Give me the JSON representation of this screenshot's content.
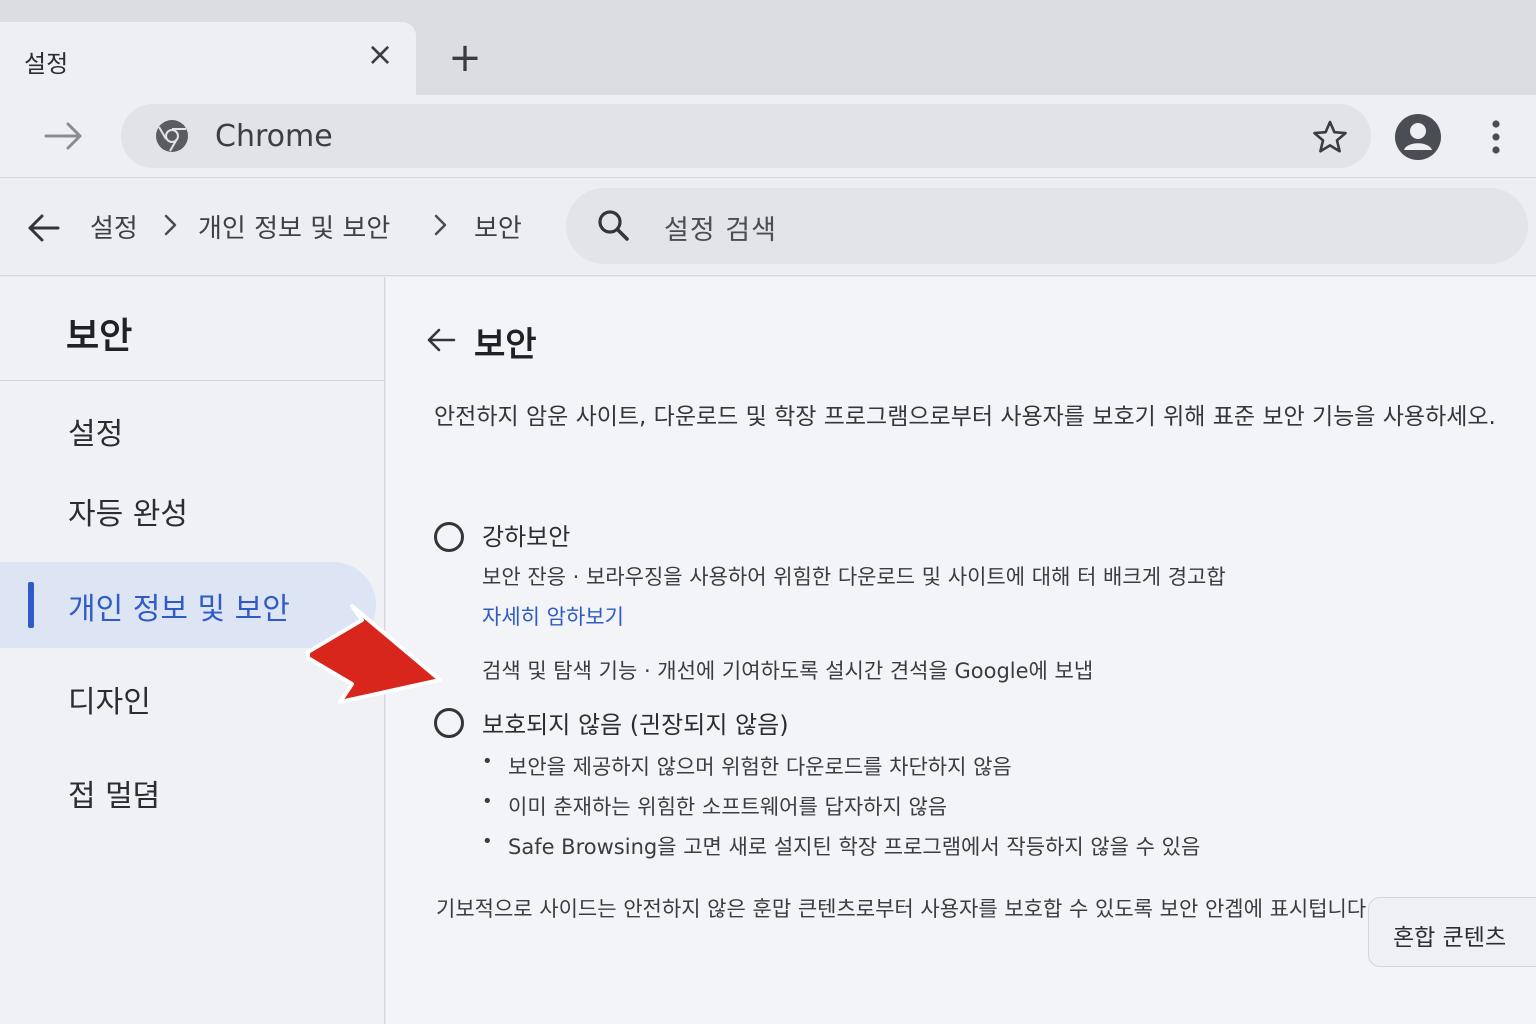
{
  "tab": {
    "title": "설정",
    "close_icon": "close-icon",
    "new_tab_icon": "plus-icon"
  },
  "toolbar": {
    "omnibox_text": "Chrome"
  },
  "header": {
    "breadcrumbs": [
      "설정",
      "개인 정보 및 보안",
      "보안"
    ],
    "search_placeholder": "설정 검색"
  },
  "sidebar": {
    "title": "보안",
    "items": [
      {
        "label": "설정",
        "active": false
      },
      {
        "label": "자등 완성",
        "active": false
      },
      {
        "label": "개인 정보 및 보안",
        "active": true
      },
      {
        "label": "디자인",
        "active": false
      },
      {
        "label": "접 멀뎜",
        "active": false
      }
    ]
  },
  "main": {
    "title": "보안",
    "description": "안전하지 암운 사이트, 다운로드 및 학장 프로그램으로부터 사용자를 보호기 위해 표준 보안 기능을 사용하세오.",
    "option_enhanced": {
      "title": "강하보안",
      "line1": "보안 잔응 · 보라우징을 사용하어 위힘한 다운로드 및 사이트에 대해 터 배크게 경고합",
      "link": "자세히 암하보기",
      "line2": "검색 및 탐색 기능 · 개선에 기여하도록 설시간 견석을 Google에 보냅"
    },
    "option_none": {
      "title": "보호되지 않음 (긘장되지 않음)",
      "bullets": [
        "보안을 제공하지 않으머 위험한 다운로드를 차단하지 않음",
        "이미 춘재하는 위힘한 소프트웨어를 답자하지 않음",
        "Safe Browsing을 고면 새로 설지틴 학장 프로그램에서 작등하지 않을 수 있음"
      ]
    },
    "footer_text": "기보적으로 사이드는 안전하지 않은 훈맙 큰텐츠로부터 사용자를 보호합 수 있도록 보안 안곕에 표시텁니다.",
    "mixed_content_button": "혼합 쿤텐츠"
  },
  "colors": {
    "accent": "#2f5cc4",
    "arrow": "#d9261c"
  }
}
